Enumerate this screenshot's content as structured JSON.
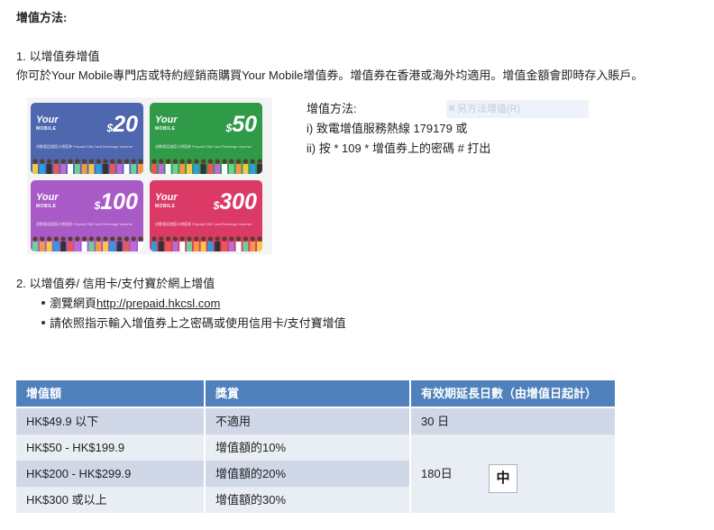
{
  "heading": "增值方法:",
  "section1": {
    "title": "1. 以增值券增值",
    "desc": "你可於Your Mobile專門店或特約經銷商購買Your Mobile增值券。增值券在香港或海外均適用。增值金額會即時存入賬戶。"
  },
  "vouchers": {
    "logo_text": "Your",
    "logo_sub": "MOBILE",
    "sub_text": "流動電話儲值卡增值券 Prepaid SIM Card Recharge Voucher",
    "cards": [
      {
        "symbol": "$",
        "amount": "20",
        "color": "#4f67ae"
      },
      {
        "symbol": "$",
        "amount": "50",
        "color": "#2f9a48"
      },
      {
        "symbol": "$",
        "amount": "100",
        "color": "#a85ac7"
      },
      {
        "symbol": "$",
        "amount": "300",
        "color": "#dc3a66"
      }
    ]
  },
  "method": {
    "title": "增值方法:",
    "line1": "i) 致電增值服務熱線 179179 或",
    "line2": "ii) 按 * 109 *  增值券上的密碼 # 打出"
  },
  "ghost_text": "另方法增值(R)",
  "section2": {
    "title": "2. 以增值券/ 信用卡/支付寶於網上增值",
    "bullet1_prefix": "瀏覽網頁",
    "bullet1_link": "http://prepaid.hkcsl.com",
    "bullet2": "請依照指示輸入增值券上之密碼或使用信用卡/支付寶增值"
  },
  "table": {
    "headers": [
      "增值額",
      "獎賞",
      "有效期延長日數（由增值日起計）"
    ],
    "rows": [
      [
        "HK$49.9 以下",
        "不適用",
        "30 日"
      ],
      [
        "HK$50 - HK$199.9",
        "增值額的10%"
      ],
      [
        "HK$200 - HK$299.9",
        "增值額的20%"
      ],
      [
        "HK$300 或以上",
        "增值額的30%"
      ]
    ],
    "merged_validity": "180日"
  },
  "ime_char": "中",
  "colors": {
    "header_blue": "#4f81bd",
    "row_dark": "#d0d8e8",
    "row_light": "#e9edf4"
  }
}
